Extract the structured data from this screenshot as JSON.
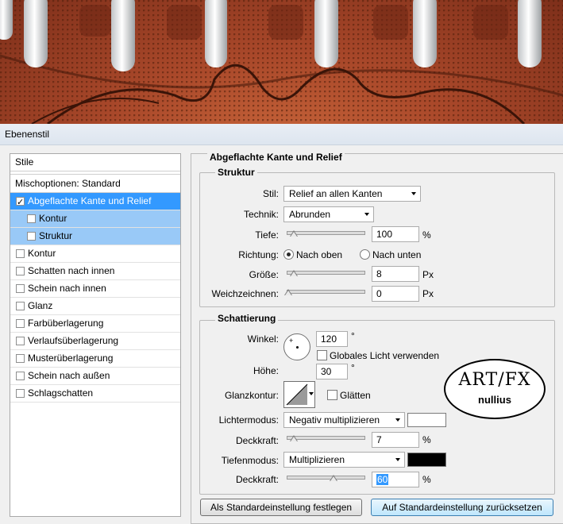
{
  "window": {
    "title": "Ebenenstil"
  },
  "sidebar": {
    "header": "Stile",
    "blending": "Mischoptionen: Standard",
    "items": [
      {
        "label": "Abgeflachte Kante und Relief",
        "checked": true,
        "selected": true
      },
      {
        "label": "Kontur",
        "checked": false,
        "sub": true
      },
      {
        "label": "Struktur",
        "checked": false,
        "sub": true
      },
      {
        "label": "Kontur",
        "checked": false
      },
      {
        "label": "Schatten nach innen",
        "checked": false
      },
      {
        "label": "Schein nach innen",
        "checked": false
      },
      {
        "label": "Glanz",
        "checked": false
      },
      {
        "label": "Farbüberlagerung",
        "checked": false
      },
      {
        "label": "Verlaufsüberlagerung",
        "checked": false
      },
      {
        "label": "Musterüberlagerung",
        "checked": false
      },
      {
        "label": "Schein nach außen",
        "checked": false
      },
      {
        "label": "Schlagschatten",
        "checked": false
      }
    ]
  },
  "main": {
    "title": "Abgeflachte Kante und Relief",
    "struktur": {
      "title": "Struktur",
      "stil_label": "Stil:",
      "stil_value": "Relief an allen Kanten",
      "technik_label": "Technik:",
      "technik_value": "Abrunden",
      "tiefe_label": "Tiefe:",
      "tiefe_value": "100",
      "tiefe_unit": "%",
      "richtung_label": "Richtung:",
      "richtung_up": "Nach oben",
      "richtung_down": "Nach unten",
      "groesse_label": "Größe:",
      "groesse_value": "8",
      "groesse_unit": "Px",
      "weich_label": "Weichzeichnen:",
      "weich_value": "0",
      "weich_unit": "Px"
    },
    "schattierung": {
      "title": "Schattierung",
      "winkel_label": "Winkel:",
      "winkel_value": "120",
      "winkel_unit": "°",
      "global_label": "Globales Licht verwenden",
      "hoehe_label": "Höhe:",
      "hoehe_value": "30",
      "hoehe_unit": "°",
      "glanz_label": "Glanzkontur:",
      "glaetten_label": "Glätten",
      "licht_label": "Lichtermodus:",
      "licht_value": "Negativ multiplizieren",
      "licht_color": "#ffffff",
      "deck1_label": "Deckkraft:",
      "deck1_value": "7",
      "deck1_unit": "%",
      "tiefen_label": "Tiefenmodus:",
      "tiefen_value": "Multiplizieren",
      "tiefen_color": "#000000",
      "deck2_label": "Deckkraft:",
      "deck2_value": "60",
      "deck2_unit": "%"
    },
    "buttons": {
      "set_default": "Als Standardeinstellung festlegen",
      "reset_default": "Auf Standardeinstellung zurücksetzen"
    },
    "logo": {
      "line1": "ART/FX",
      "line2": "nullius"
    }
  }
}
